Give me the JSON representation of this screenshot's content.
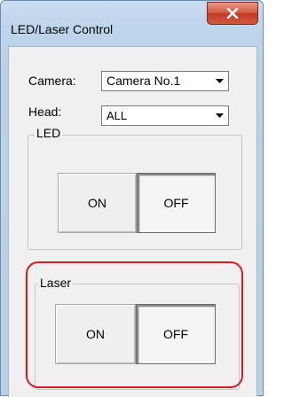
{
  "window": {
    "title": "LED/Laser Control",
    "close_glyph": "x"
  },
  "camera": {
    "label": "Camera:",
    "selected": "Camera No.1"
  },
  "head": {
    "label": "Head:",
    "selected": "ALL"
  },
  "led": {
    "group_label": "LED",
    "on_label": "ON",
    "off_label": "OFF",
    "state": "OFF"
  },
  "laser": {
    "group_label": "Laser",
    "on_label": "ON",
    "off_label": "OFF",
    "state": "OFF"
  },
  "annotation": {
    "highlight_color": "#e0191c"
  }
}
